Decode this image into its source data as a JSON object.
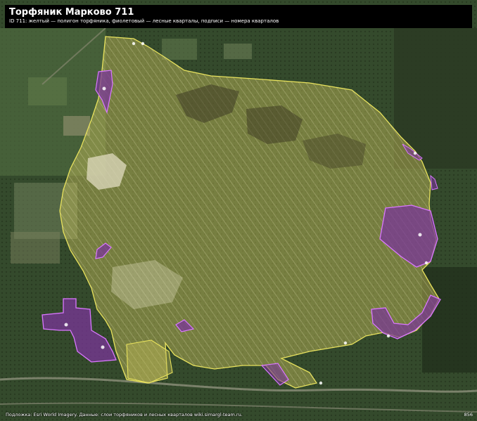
{
  "header": {
    "title": "Торфяник Марково 711",
    "subtitle": "ID 711: желтый — полигон торфяника, фиолетовый — лесные кварталы, подписи — номера кварталов"
  },
  "legend": {
    "peat_color": "#d8d65a",
    "quarter_color": "#8a3fa8",
    "quarter_border_color": "#d977ff"
  },
  "footer": {
    "attribution": "Подложка: Esri World Imagery. Данные: слои торфяников и лесных кварталов wiki.simargl-team.ru.",
    "code": "856"
  }
}
